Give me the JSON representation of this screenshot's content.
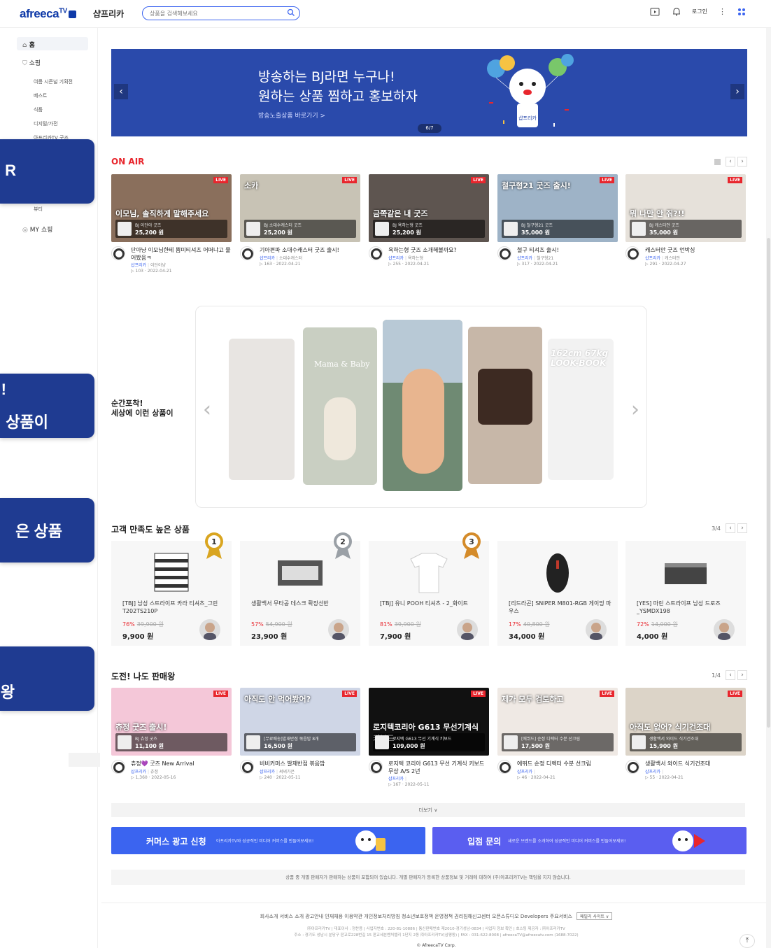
{
  "header": {
    "logo": "afreecaTV",
    "logo_suffix": "TV",
    "brand": "샵프리카",
    "search_placeholder": "상품을 검색해보세요",
    "login": "로그인"
  },
  "sidebar": {
    "home": "홈",
    "shop": "쇼핑",
    "sub_items": [
      "여름 시즌널 기획전",
      "베스트",
      "식품",
      "디지털/가전",
      "아프리카TV 굿즈"
    ],
    "sub_item_bottom": "뷰티",
    "my_shop": "MY 쇼핑"
  },
  "callouts": [
    "R",
    "!",
    "상품이",
    "은 상품",
    "왕"
  ],
  "banner": {
    "line1": "방송하는 BJ라면 누구나!",
    "line2": "원하는 상품 찜하고 홍보하자",
    "link": "방송노출상품 바로가기 >",
    "page": "6/7",
    "bg_color": "#2a4aab"
  },
  "on_air": {
    "title": "ON AIR",
    "items": [
      {
        "thumb_text": "이모님, 솔직하게 말해주세요",
        "product": "BJ 이단아 굿즈",
        "price": "25,200 원",
        "title": "단아냥 이모님한테 쁨미티셔츠 어떠냐고 물어봤음ㅋ",
        "seller": "샵프리카",
        "bj": "이단아냥",
        "meta": "▷ 103 · 2022-04-21",
        "bg": "#8a6f5c"
      },
      {
        "thumb_text": "소카",
        "product": "BJ 소대수캐스터 굿즈",
        "price": "25,200 원",
        "title": "기아편파 소대수캐스터 굿즈 출시!",
        "seller": "샵프리카",
        "bj": "소대수캐스터",
        "meta": "▷ 163 · 2022-04-21",
        "bg": "#c8c3b5"
      },
      {
        "thumb_text": "금쪽같은 내 굿즈",
        "product": "BJ 욕하는형 굿즈",
        "price": "25,200 원",
        "title": "욕하는형 굿즈 소개해볼까요?",
        "seller": "샵프리카",
        "bj": "욕하는형",
        "meta": "▷ 255 · 2022-04-21",
        "bg": "#5e5550"
      },
      {
        "thumb_text": "철구형21 굿즈 출시!",
        "product": "BJ 철구형21 굿즈",
        "price": "35,000 원",
        "title": "철구 티셔츠 출시!",
        "seller": "샵프리카",
        "bj": "철구형21",
        "meta": "▷ 317 · 2022-04-21",
        "bg": "#9eb3c7"
      },
      {
        "thumb_text": "뭐 나만 안 줘?!!",
        "product": "BJ 캐스터안 굿즈",
        "price": "35,000 원",
        "title": "캐스터안 굿즈 언박싱",
        "seller": "샵프리카",
        "bj": "캐스터안",
        "meta": "▷ 291 · 2022-04-27",
        "bg": "#e6e1da"
      }
    ]
  },
  "moment": {
    "caption_line1": "순간포착!",
    "caption_line2": "세상에 이런 상품이",
    "img_labels": [
      "",
      "Mama & Baby",
      "",
      "",
      "162cm 67kg LOOK-BOOK"
    ]
  },
  "satisfaction": {
    "title": "고객 만족도 높은 상품",
    "page": "3/4",
    "items": [
      {
        "name": "[TBJ] 남성 스트라이프 카라 티셔츠_그린 T202TS210P",
        "discount": "76%",
        "old_price": "39,900 원",
        "price": "9,900 원",
        "medal": "1"
      },
      {
        "name": "생활백서 무타공 데스크 확장선반",
        "discount": "57%",
        "old_price": "54,900 원",
        "price": "23,900 원",
        "medal": "2"
      },
      {
        "name": "[TBJ] 유니 POOH 티셔츠 - 2_화이트",
        "discount": "81%",
        "old_price": "39,900 원",
        "price": "7,900 원",
        "medal": "3"
      },
      {
        "name": "[리드라곤] SNIPER M801-RGB 게이밍 마우스",
        "discount": "17%",
        "old_price": "40,800 원",
        "price": "34,000 원",
        "medal": ""
      },
      {
        "name": "[YES] 마린 스트라이프 남성 드로즈_YSMDX198",
        "discount": "72%",
        "old_price": "14,000 원",
        "price": "4,000 원",
        "medal": ""
      }
    ]
  },
  "challenge": {
    "title": "도전! 나도 판매왕",
    "page": "1/4",
    "items": [
      {
        "thumb_text": "츄정 굿즈 출시!",
        "product": "BJ 츄정 굿즈",
        "price": "11,100 원",
        "title": "츄정💜 굿즈 New Arrival",
        "seller": "샵프리카",
        "bj": "츄정",
        "meta": "▷ 1,360 · 2022-05-16",
        "bg": "#f4c7d8"
      },
      {
        "thumb_text": "아직도 안 먹어봤어?",
        "product": "[무료배송]발재반점 볶음밥 8개",
        "price": "16,500 원",
        "title": "비비커머스 발재반점 볶음밥",
        "seller": "샵프리카",
        "bj": "써써가은",
        "meta": "▷ 240 · 2022-05-11",
        "bg": "#cfd6e6"
      },
      {
        "thumb_text": "로지텍코리아 G613 무선기계식키보드",
        "product": "로지텍 G613 무선 기계식 키보드",
        "price": "109,000 원",
        "title": "로지텍 코리아 G613 무선 기계식 키보드 무상 A/S 2년",
        "seller": "샵프리카",
        "bj": "",
        "meta": "▷ 167 · 2022-05-11",
        "bg": "#111111"
      },
      {
        "thumb_text": "제가 모두 검토하고",
        "product": "[에뛰드] 순정 디렉터 수분 선크림",
        "price": "17,500 원",
        "title": "에뛰드 순정 디렉터 수분 선크림",
        "seller": "샵프리카",
        "bj": "",
        "meta": "▷ 46 · 2022-04-21",
        "bg": "#efe9e4"
      },
      {
        "thumb_text": "아직도 없어? 식기건조대",
        "product": "생활백서 와이드 식기건조대",
        "price": "15,900 원",
        "title": "생활백서 와이드 식기건조대",
        "seller": "샵프리카",
        "bj": "",
        "meta": "▷ 55 · 2022-04-21",
        "bg": "#dcd4c8"
      }
    ]
  },
  "more_label": "더보기 ∨",
  "ads": {
    "left_big": "커머스 광고 신청",
    "left_small": "아프리카TV와 성공적인 미디어 커머스를 만들어보세요!",
    "right_big": "입점 문의",
    "right_small": "새로운 브랜드를 소개하여 성공적인 미디어 커머스를 만들어보세요!",
    "left_color": "#3b64f0",
    "right_color": "#5a5ef0"
  },
  "notice": "상품 중 개별 판매자가 판매하는 상품이 포함되어 있습니다. 개별 판매자가 등록한 상품정보 및 거래에 대하여 (주)아프리카TV는 책임을 지지 않습니다.",
  "footer": {
    "links": "회사소개  서비스 소개  광고안내  인재채용  이용약관  개인정보처리방침  청소년보호정책  운영정책  권리침해신고센터  오픈스튜디오  Developers  주요서비스",
    "select": "패밀리 사이트 ∨",
    "info1": "㈜아프리카TV | 대표이사 : 정찬용 | 사업자번호 : 220-81-10886 | 통신판매번호 제2010-경기성남-0834 | 사업자 정보 확인 | 호스팅 제공자 : ㈜아프리카TV",
    "info2": "주소 : 경기도 성남시 분당구 판교로228번길 15 판교세븐벤처밸리 1단지 2동 ㈜아프리카TV(삼평동) | FAX : 031-622-8008 | afreecaTV@afreecatv.com (1688-7022)",
    "copy": "© AfreecaTV Corp."
  }
}
